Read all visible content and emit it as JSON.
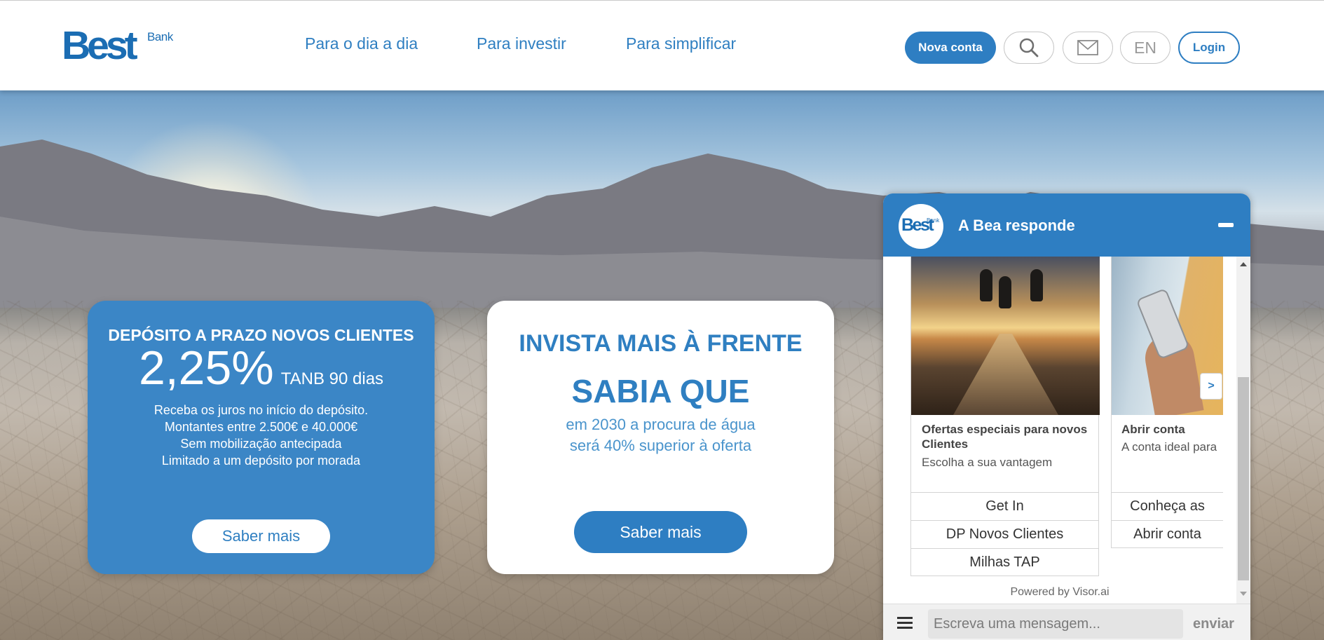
{
  "brand": {
    "word": "Best",
    "sub": "Bank"
  },
  "nav": [
    {
      "label": "Para o dia a dia"
    },
    {
      "label": "Para investir"
    },
    {
      "label": "Para simplificar"
    }
  ],
  "header_actions": {
    "new_account": "Nova conta",
    "language": "EN",
    "login": "Login",
    "search_icon": "search-icon",
    "mail_icon": "mail-icon"
  },
  "promo_deposit": {
    "title": "DEPÓSITO A PRAZO NOVOS CLIENTES",
    "rate": "2,25%",
    "rate_note": "TANB 90 dias",
    "lines": [
      "Receba os juros no início do depósito.",
      "Montantes entre 2.500€ e 40.000€",
      "Sem mobilização antecipada",
      "Limitado a um depósito por morada"
    ],
    "cta": "Saber mais"
  },
  "promo_invest": {
    "title": "INVISTA MAIS À FRENTE",
    "headline": "SABIA QUE",
    "lines": [
      "em 2030 a procura de água",
      "será 40% superior à oferta"
    ],
    "cta": "Saber mais"
  },
  "chat": {
    "avatar_word": "Best",
    "avatar_sub": "Bank",
    "title": "A Bea responde",
    "cards": [
      {
        "heading": "Ofertas especiais para novos Clientes",
        "description": "Escolha a sua vantagem",
        "options": [
          "Get In",
          "DP Novos Clientes",
          "Milhas TAP"
        ]
      },
      {
        "heading": "Abrir conta",
        "description": "A conta ideal para",
        "options": [
          "Conheça as",
          "Abrir conta"
        ]
      }
    ],
    "next_label": ">",
    "powered_by": "Powered by Visor.ai",
    "input_placeholder": "Escreva uma mensagem...",
    "send_label": "enviar"
  },
  "colors": {
    "brand_blue": "#2e7ec2",
    "card_blue": "#3b86c6",
    "nav_text": "#2f7fc1"
  }
}
